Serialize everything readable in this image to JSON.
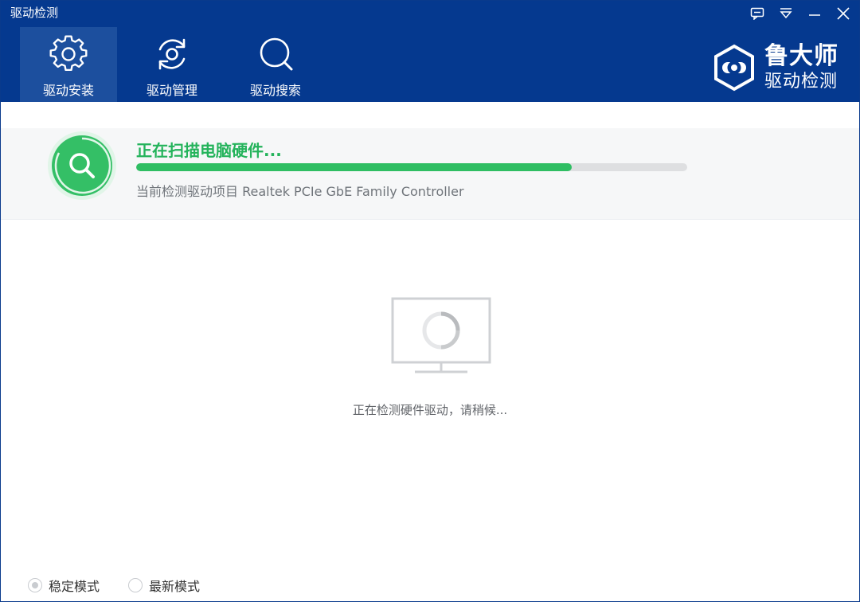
{
  "window": {
    "title": "驱动检测"
  },
  "tabs": [
    {
      "label": "驱动安装",
      "icon": "gear-icon",
      "active": true
    },
    {
      "label": "驱动管理",
      "icon": "refresh-gear-icon",
      "active": false
    },
    {
      "label": "驱动搜索",
      "icon": "search-icon",
      "active": false
    }
  ],
  "brand": {
    "name": "鲁大师",
    "subtitle": "驱动检测",
    "logo_icon": "hexagon-gear-logo"
  },
  "scan": {
    "title": "正在扫描电脑硬件...",
    "progress": 0.79,
    "detail": "当前检测驱动项目 Realtek PCIe GbE Family Controller"
  },
  "status": {
    "message": "正在检测硬件驱动，请稍候..."
  },
  "modes": [
    {
      "label": "稳定模式",
      "checked": true
    },
    {
      "label": "最新模式",
      "checked": false
    }
  ],
  "colors": {
    "header_bg": "#05398f",
    "active_tab_bg": "#1c4f9e",
    "accent_green": "#2fbe63",
    "panel_bg": "#f6f7f8"
  }
}
